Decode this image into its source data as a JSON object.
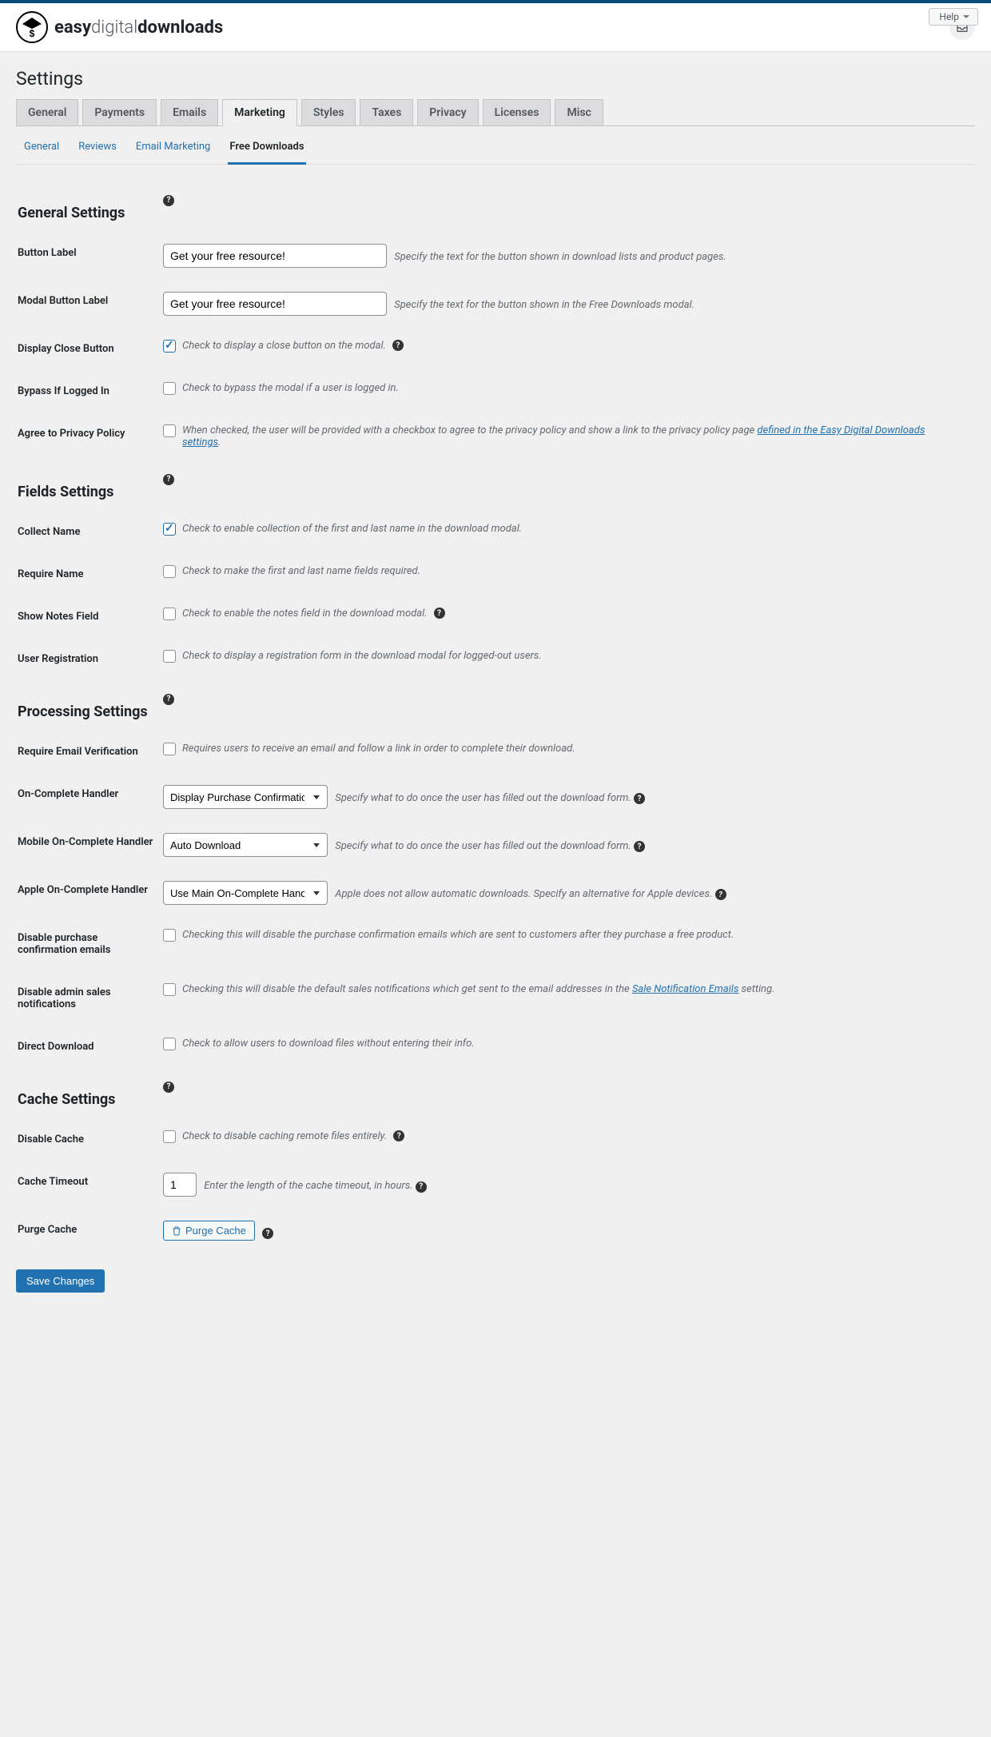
{
  "header": {
    "logo_easy": "easy",
    "logo_digital": "digital",
    "logo_downloads": "downloads",
    "help_label": "Help"
  },
  "page_title": "Settings",
  "tabs": [
    {
      "label": "General"
    },
    {
      "label": "Payments"
    },
    {
      "label": "Emails"
    },
    {
      "label": "Marketing",
      "active": true
    },
    {
      "label": "Styles"
    },
    {
      "label": "Taxes"
    },
    {
      "label": "Privacy"
    },
    {
      "label": "Licenses"
    },
    {
      "label": "Misc"
    }
  ],
  "subtabs": [
    {
      "label": "General"
    },
    {
      "label": "Reviews"
    },
    {
      "label": "Email Marketing"
    },
    {
      "label": "Free Downloads",
      "active": true
    }
  ],
  "sections": {
    "general": "General Settings",
    "fields": "Fields Settings",
    "processing": "Processing Settings",
    "cache": "Cache Settings"
  },
  "fields": {
    "button_label": {
      "label": "Button Label",
      "value": "Get your free resource!",
      "desc": "Specify the text for the button shown in download lists and product pages."
    },
    "modal_button_label": {
      "label": "Modal Button Label",
      "value": "Get your free resource!",
      "desc": "Specify the text for the button shown in the Free Downloads modal."
    },
    "display_close": {
      "label": "Display Close Button",
      "desc": "Check to display a close button on the modal.",
      "checked": true
    },
    "bypass_logged": {
      "label": "Bypass If Logged In",
      "desc": "Check to bypass the modal if a user is logged in.",
      "checked": false
    },
    "agree_privacy": {
      "label": "Agree to Privacy Policy",
      "desc_pre": "When checked, the user will be provided with a checkbox to agree to the privacy policy and show a link to the privacy policy page ",
      "link": "defined in the Easy Digital Downloads settings",
      "desc_post": ".",
      "checked": false
    },
    "collect_name": {
      "label": "Collect Name",
      "desc": "Check to enable collection of the first and last name in the download modal.",
      "checked": true
    },
    "require_name": {
      "label": "Require Name",
      "desc": "Check to make the first and last name fields required.",
      "checked": false
    },
    "notes_field": {
      "label": "Show Notes Field",
      "desc": "Check to enable the notes field in the download modal.",
      "checked": false
    },
    "user_reg": {
      "label": "User Registration",
      "desc": "Check to display a registration form in the download modal for logged-out users.",
      "checked": false
    },
    "require_email": {
      "label": "Require Email Verification",
      "desc": "Requires users to receive an email and follow a link in order to complete their download.",
      "checked": false
    },
    "on_complete": {
      "label": "On-Complete Handler",
      "value": "Display Purchase Confirmation",
      "desc": "Specify what to do once the user has filled out the download form."
    },
    "mobile_on_complete": {
      "label": "Mobile On-Complete Handler",
      "value": "Auto Download",
      "desc": "Specify what to do once the user has filled out the download form."
    },
    "apple_on_complete": {
      "label": "Apple On-Complete Handler",
      "value": "Use Main On-Complete Handler",
      "desc": "Apple does not allow automatic downloads. Specify an alternative for Apple devices."
    },
    "disable_purchase_email": {
      "label": "Disable purchase confirmation emails",
      "desc": "Checking this will disable the purchase confirmation emails which are sent to customers after they purchase a free product.",
      "checked": false
    },
    "disable_admin_notif": {
      "label": "Disable admin sales notifications",
      "desc_pre": "Checking this will disable the default sales notifications which get sent to the email addresses in the ",
      "link": "Sale Notification Emails",
      "desc_post": " setting.",
      "checked": false
    },
    "direct_download": {
      "label": "Direct Download",
      "desc": "Check to allow users to download files without entering their info.",
      "checked": false
    },
    "disable_cache": {
      "label": "Disable Cache",
      "desc": "Check to disable caching remote files entirely.",
      "checked": false
    },
    "cache_timeout": {
      "label": "Cache Timeout",
      "value": "1",
      "desc": "Enter the length of the cache timeout, in hours."
    },
    "purge_cache": {
      "label": "Purge Cache",
      "button": "Purge Cache"
    }
  },
  "save_label": "Save Changes"
}
